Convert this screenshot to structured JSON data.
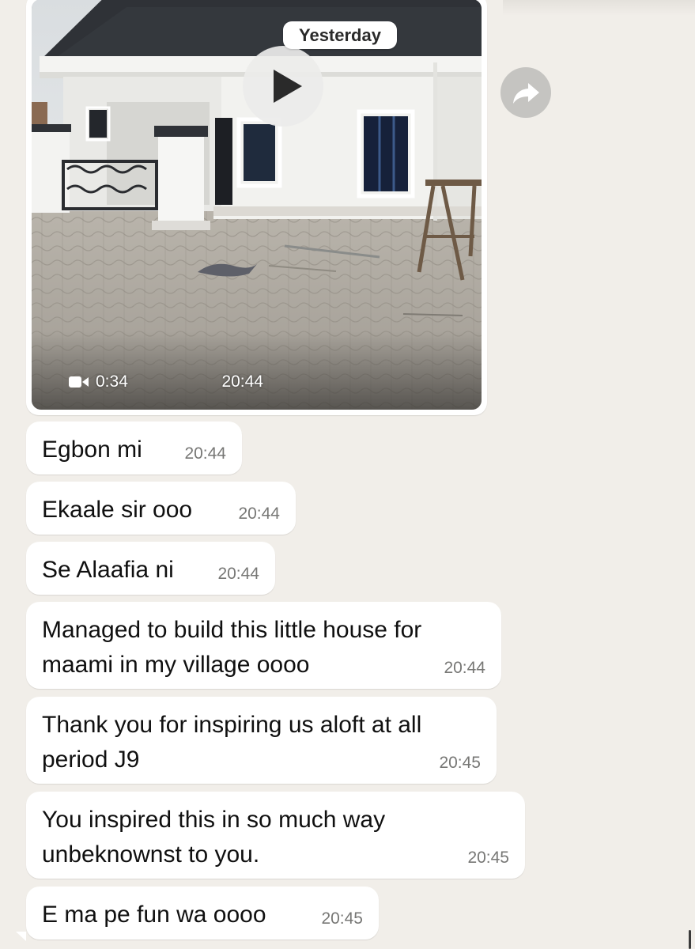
{
  "video": {
    "date_chip": "Yesterday",
    "duration": "0:34",
    "time": "20:44",
    "icons": {
      "play": "play-icon",
      "camera": "video-camera-icon",
      "forward": "forward-share-icon"
    }
  },
  "messages": [
    {
      "lines": [
        "Egbon mi"
      ],
      "time": "20:44"
    },
    {
      "lines": [
        "Ekaale sir ooo"
      ],
      "time": "20:44"
    },
    {
      "lines": [
        "Se Alaafia ni"
      ],
      "time": "20:44"
    },
    {
      "lines": [
        "Managed to build this little house for",
        "maami in my village oooo"
      ],
      "time": "20:44"
    },
    {
      "lines": [
        "Thank you for inspiring us aloft at all",
        "period J9"
      ],
      "time": "20:45"
    },
    {
      "lines": [
        "You inspired this in so much way",
        "unbeknownst to you."
      ],
      "time": "20:45"
    },
    {
      "lines": [
        "E ma pe fun wa oooo"
      ],
      "time": "20:45"
    }
  ],
  "colors": {
    "background": "#f1eee9",
    "bubble": "#ffffff",
    "timestamp": "#777775"
  }
}
